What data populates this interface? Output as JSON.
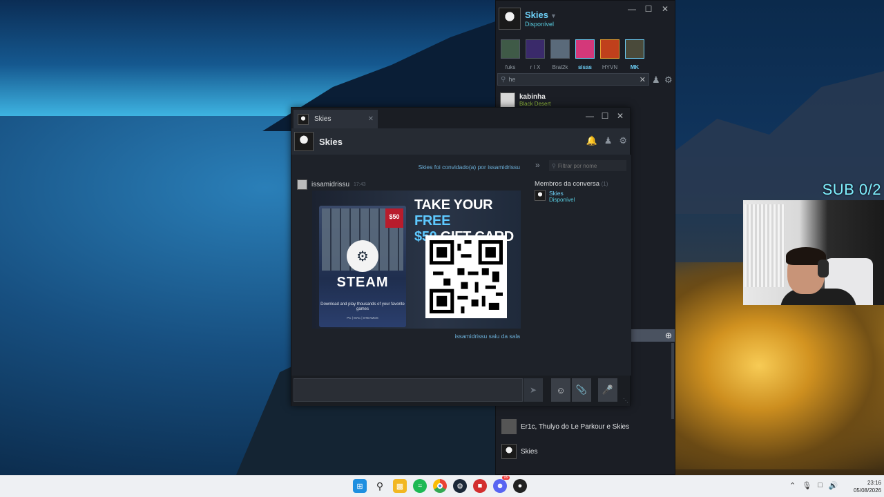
{
  "overlay": {
    "sub_counter": "SUB 0/2"
  },
  "friends_window": {
    "user": {
      "name": "Skies",
      "status": "Disponível"
    },
    "favorites": [
      {
        "name": "fuks",
        "online": false,
        "color": "#3f5a47"
      },
      {
        "name": "r I X",
        "online": false,
        "color": "#3a2a6a"
      },
      {
        "name": "Bral2k",
        "online": false,
        "color": "#5a6a7a"
      },
      {
        "name": "sisas",
        "online": true,
        "color": "#d4387a"
      },
      {
        "name": "HYVN",
        "online": false,
        "color": "#c0401c"
      },
      {
        "name": "MK",
        "online": true,
        "color": "#4a4a3a"
      }
    ],
    "search": {
      "value": "he"
    },
    "friend": {
      "name": "kabinha",
      "game": "Black Desert"
    },
    "groups": [
      {
        "title": "Er1c, Thulyo do Le Parkour e Skies"
      },
      {
        "title": "Skies"
      }
    ]
  },
  "chat_window": {
    "tab_name": "Skies",
    "header_name": "Skies",
    "invite_msg": "Skies foi convidado(a) por issamidrissu",
    "author": "issamidrissu",
    "time": "17:43",
    "promo": {
      "badge": "$50",
      "steam": "STEAM",
      "download": "Download and play thousands of your favorite games",
      "platforms": "PC | MAC | STEAMOS",
      "title_line1_a": "TAKE YOUR ",
      "title_line1_b": "FREE",
      "title_line2_a": "$50",
      "title_line2_b": " GIFT CARD"
    },
    "left_msg": "issamidrissu saiu da sala",
    "members_search_placeholder": "Filtrar por nome",
    "members_title": "Membros da conversa",
    "members_count": "(1)",
    "member": {
      "name": "Skies",
      "status": "Disponível"
    }
  },
  "taskbar": {
    "time": "23:16",
    "date": "05/08/2026",
    "discord_badge": "99"
  }
}
